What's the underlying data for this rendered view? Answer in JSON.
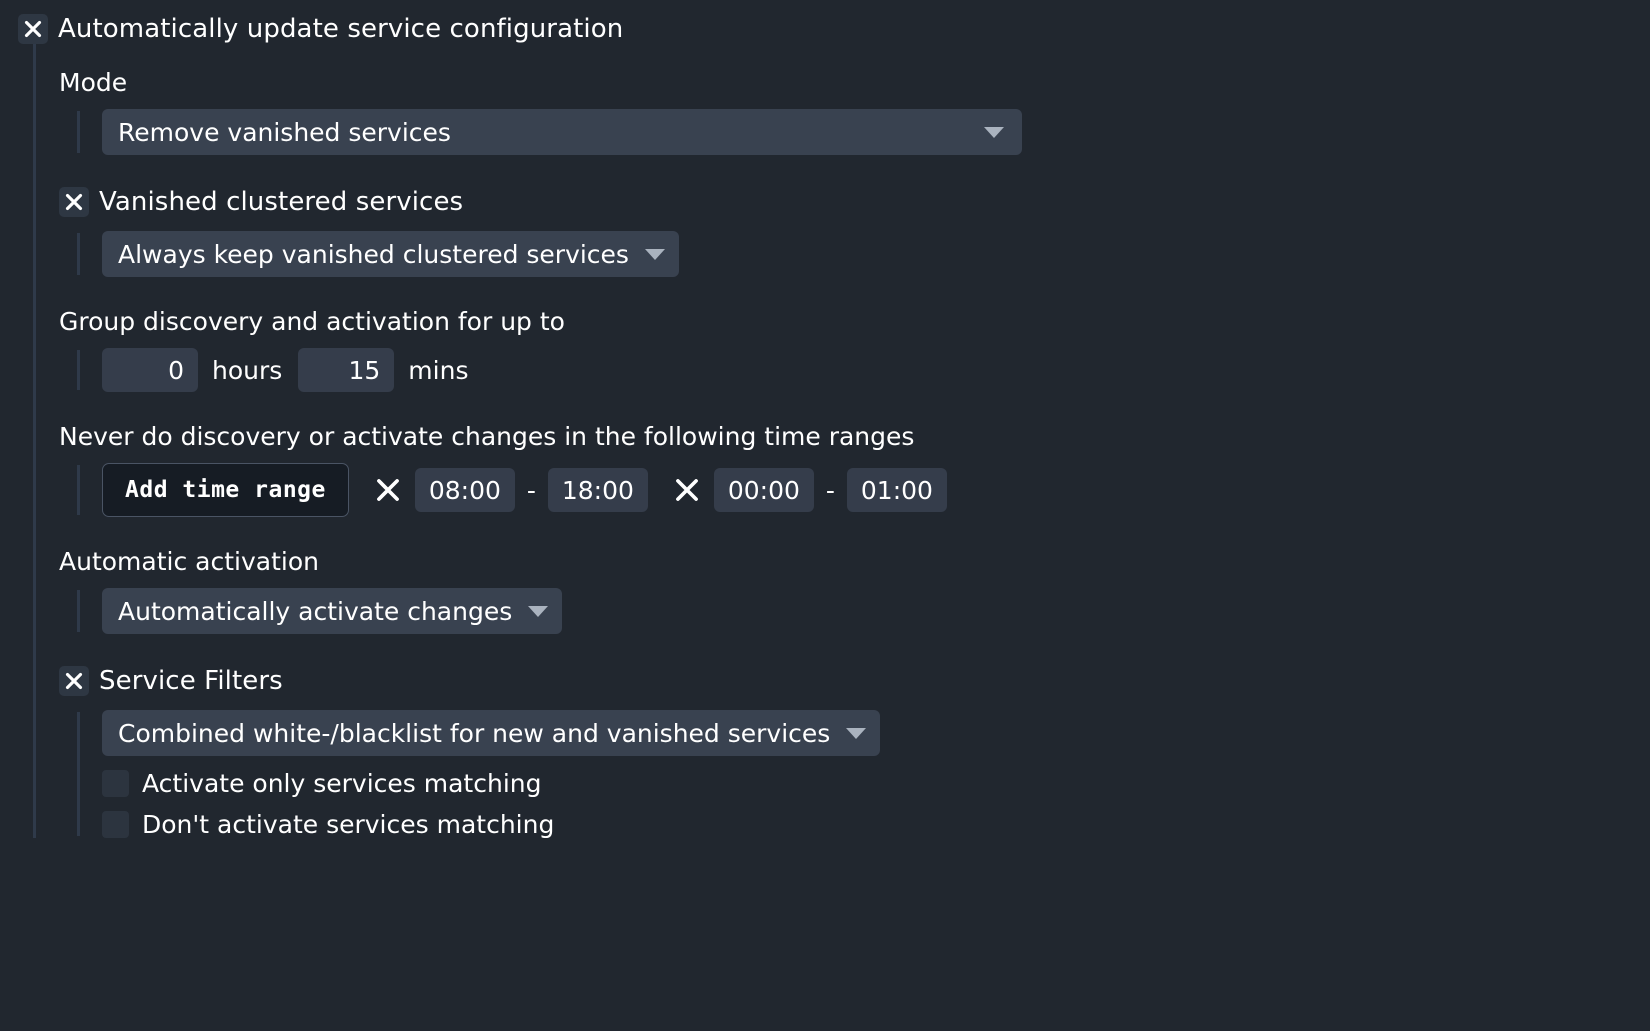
{
  "root": {
    "checkbox_label": "Automatically update service configuration",
    "checked": true,
    "checkbox_icon": "x-mark-icon"
  },
  "mode": {
    "title": "Mode",
    "select_value": "Remove vanished services",
    "caret_icon": "chevron-down-icon"
  },
  "vanished_clustered": {
    "checkbox_label": "Vanished clustered services",
    "checked": true,
    "select_value": "Always keep vanished clustered services"
  },
  "group_discovery": {
    "title": "Group discovery and activation for up to",
    "hours_value": "0",
    "hours_label": "hours",
    "mins_value": "15",
    "mins_label": "mins"
  },
  "time_ranges": {
    "title": "Never do discovery or activate changes in the following time ranges",
    "add_button_label": "Add time range",
    "separator": "-",
    "delete_icon": "x-mark-icon",
    "ranges": [
      {
        "start": "08:00",
        "end": "18:00"
      },
      {
        "start": "00:00",
        "end": "01:00"
      }
    ]
  },
  "automatic_activation": {
    "title": "Automatic activation",
    "select_value": "Automatically activate changes"
  },
  "service_filters": {
    "checkbox_label": "Service Filters",
    "checked": true,
    "select_value": "Combined white-/blacklist for new and vanished services",
    "filters": [
      {
        "label": "Activate only services matching",
        "checked": false
      },
      {
        "label": "Don't activate services matching",
        "checked": false
      }
    ]
  },
  "colors": {
    "background": "#21272f",
    "input_bg": "#353d4b",
    "select_bg": "#394250",
    "checkbox_bg": "#2e3743",
    "guide_line": "#2f3a4a",
    "button_bg": "#161c24",
    "button_border": "#4a5464",
    "text": "#ffffff",
    "caret": "#aab3bf"
  }
}
